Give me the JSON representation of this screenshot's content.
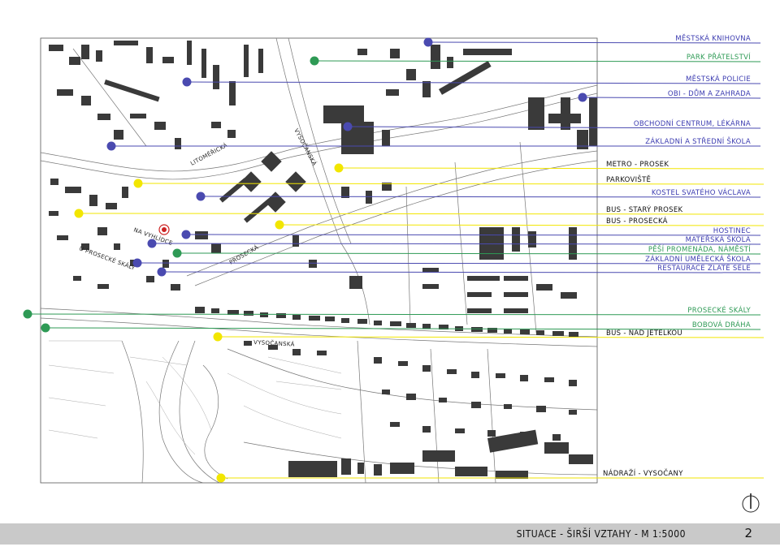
{
  "map": {
    "streets": {
      "litomericka": "LITOMĚŘICKÁ",
      "vysocanska_north": "VYSOČANSKÁ",
      "na_vyhlidce": "NA VYHLÍDCE",
      "u_proseckych_skal": "U PROSECKÉ SKÁLY",
      "prosecka": "PROSECKÁ",
      "vysocanska_south": "VYSOČANSKÁ"
    },
    "legend": [
      {
        "label": "MĚSTSKÁ KNIHOVNA",
        "color": "#3b3bb0"
      },
      {
        "label": "PARK PŘÁTELSTVÍ",
        "color": "#2e9a55"
      },
      {
        "label": "MĚSTSKÁ POLICIE",
        "color": "#3b3bb0"
      },
      {
        "label": "OBI - DŮM A ZAHRADA",
        "color": "#3b3bb0"
      },
      {
        "label": "OBCHODNÍ CENTRUM, LÉKÁRNA",
        "color": "#3b3bb0"
      },
      {
        "label": "ZÁKLADNÍ A STŘEDNÍ ŠKOLA",
        "color": "#3b3bb0"
      },
      {
        "label": "METRO - PROSEK",
        "color": "#111111"
      },
      {
        "label": "PARKOVIŠTĚ",
        "color": "#111111"
      },
      {
        "label": "KOSTEL SVATÉHO VÁCLAVA",
        "color": "#3b3bb0"
      },
      {
        "label": "BUS - STARÝ PROSEK",
        "color": "#111111"
      },
      {
        "label": "BUS - PROSECKÁ",
        "color": "#111111"
      },
      {
        "label": "HOSTINEC",
        "color": "#3b3bb0"
      },
      {
        "label": "MATEŘSKÁ ŠKOLA",
        "color": "#3b3bb0"
      },
      {
        "label": "PĚŠÍ PROMENÁDA, NÁMĚSTÍ",
        "color": "#2e9a55"
      },
      {
        "label": "ZÁKLADNÍ UMĚLECKÁ ŠKOLA",
        "color": "#3b3bb0"
      },
      {
        "label": "RESTAURACE ZLATÉ SELE",
        "color": "#3b3bb0"
      },
      {
        "label": "PROSECKÉ SKÁLY",
        "color": "#2e9a55"
      },
      {
        "label": "BUS - NAD JETELKOU",
        "color": "#111111"
      },
      {
        "label": "BOBOVÁ DRÁHA",
        "color": "#2e9a55"
      },
      {
        "label": "NÁDRAŽÍ - VYSOČANY",
        "color": "#111111"
      }
    ],
    "colors": {
      "civic": "#4a4ab0",
      "green": "#2e9a55",
      "transport": "#f2e600",
      "buildings": "#3a3a3a",
      "marker": "#cc2222"
    }
  },
  "footer": {
    "title": "SITUACE - ŠIRŠÍ VZTAHY  -  M 1:5000",
    "page": "2"
  },
  "north_arrow": {
    "icon": "north-arrow-icon"
  }
}
